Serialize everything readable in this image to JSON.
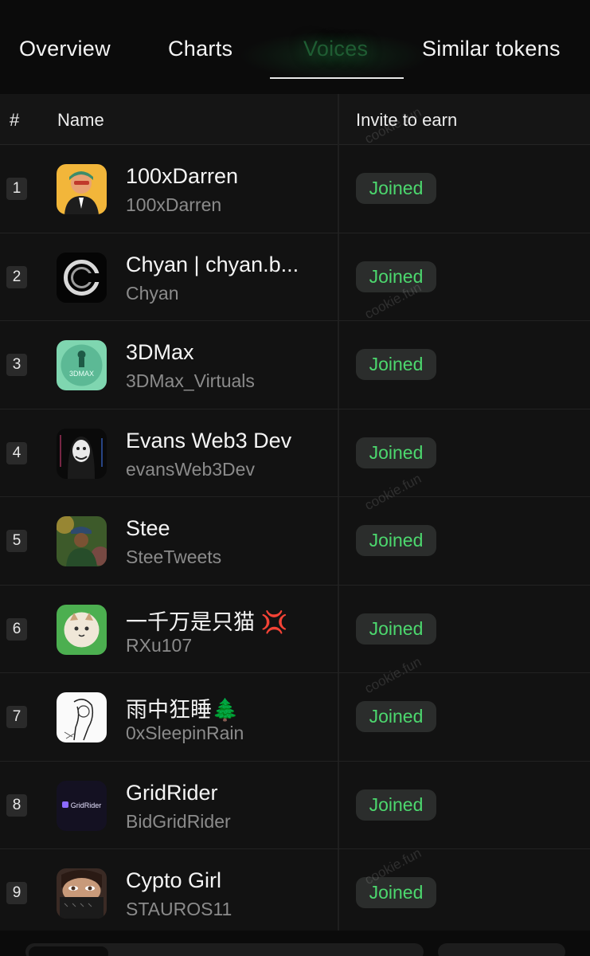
{
  "tabs": [
    {
      "label": "Overview",
      "active": false
    },
    {
      "label": "Charts",
      "active": false
    },
    {
      "label": "Voices",
      "active": true
    },
    {
      "label": "Similar tokens",
      "active": false
    }
  ],
  "table": {
    "headers": {
      "rank": "#",
      "name": "Name",
      "invite": "Invite to earn"
    },
    "rows": [
      {
        "rank": "1",
        "name": "100xDarren",
        "handle": "100xDarren",
        "status": "Joined"
      },
      {
        "rank": "2",
        "name": "Chyan | chyan.b...",
        "handle": "Chyan",
        "status": "Joined"
      },
      {
        "rank": "3",
        "name": "3DMax",
        "handle": "3DMax_Virtuals",
        "status": "Joined"
      },
      {
        "rank": "4",
        "name": "Evans Web3 Dev",
        "handle": "evansWeb3Dev",
        "status": "Joined"
      },
      {
        "rank": "5",
        "name": "Stee",
        "handle": "SteeTweets",
        "status": "Joined"
      },
      {
        "rank": "6",
        "name": "一千万是只猫 💢",
        "handle": "RXu107",
        "status": "Joined"
      },
      {
        "rank": "7",
        "name": "雨中狂睡🌲",
        "handle": "0xSleepinRain",
        "status": "Joined"
      },
      {
        "rank": "8",
        "name": "GridRider",
        "handle": "BidGridRider",
        "status": "Joined"
      },
      {
        "rank": "9",
        "name": "Cypto Girl",
        "handle": "STAUROS11",
        "status": "Joined"
      }
    ]
  },
  "watermark": "cookie.fun",
  "avatar_small_text": {
    "3DMax": "3DMAX",
    "GridRider": "GridRider"
  },
  "colors": {
    "background": "#0b0b0b",
    "joined_text": "#4cd86e",
    "pill_bg": "#2b2d2c",
    "active_tab": "#1f5d33"
  }
}
